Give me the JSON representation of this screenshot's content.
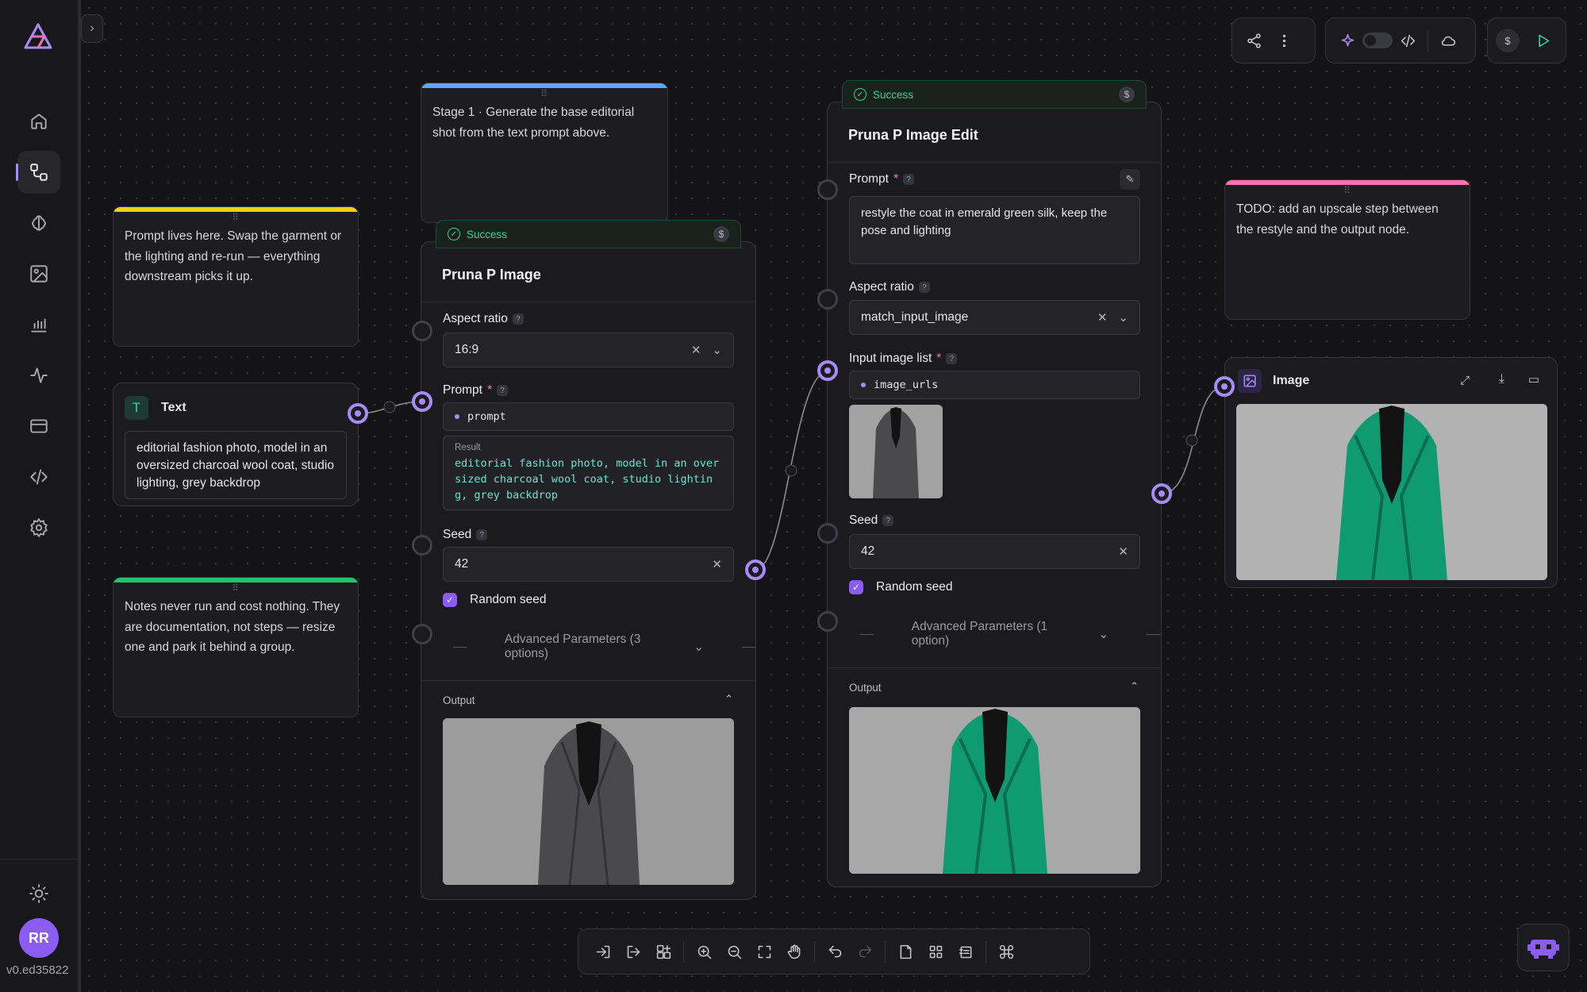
{
  "app": {
    "version": "v0.ed35822",
    "user_initials": "RR",
    "accent": "#a78bfa"
  },
  "sidebar": {
    "items": [
      {
        "name": "home",
        "icon": "home-icon",
        "active": false
      },
      {
        "name": "workflows",
        "icon": "workflow-icon",
        "active": true
      },
      {
        "name": "models",
        "icon": "brain-icon",
        "active": false
      },
      {
        "name": "gallery",
        "icon": "image-icon",
        "active": false
      },
      {
        "name": "analytics",
        "icon": "bar-chart-icon",
        "active": false
      },
      {
        "name": "activity",
        "icon": "activity-icon",
        "active": false
      },
      {
        "name": "billing",
        "icon": "credit-card-icon",
        "active": false
      },
      {
        "name": "api",
        "icon": "code-icon",
        "active": false
      },
      {
        "name": "settings",
        "icon": "gear-icon",
        "active": false
      }
    ]
  },
  "notes": {
    "yellow": {
      "text": "Prompt lives here. Swap the garment or the lighting and re-run — everything downstream picks it up.",
      "color": "#facc15"
    },
    "green": {
      "text": "Notes never run and cost nothing. They are documentation, not steps — resize one and park it behind a group.",
      "color": "#22c55e"
    },
    "blue": {
      "text": "Stage 1 · Generate the base editorial shot from the text prompt above.",
      "color": "#60a5fa"
    },
    "pink": {
      "text": "TODO: add an upscale step between the restyle and the output node.",
      "color": "#f472b6"
    }
  },
  "text_node": {
    "title": "Text",
    "value": "editorial fashion photo, model in an oversized charcoal wool coat, studio lighting, grey backdrop"
  },
  "node1": {
    "status": "Success",
    "title": "Pruna P Image",
    "aspect_label": "Aspect ratio",
    "aspect_value": "16:9",
    "prompt_label": "Prompt",
    "prompt_var": "prompt",
    "result_label": "Result",
    "result_value": "editorial fashion photo, model in an oversized charcoal wool coat, studio lighting, grey backdrop",
    "seed_label": "Seed",
    "seed_value": "42",
    "random_seed_label": "Random seed",
    "advanced_label": "Advanced Parameters (3 options)",
    "output_label": "Output"
  },
  "node2": {
    "status": "Success",
    "title": "Pruna P Image Edit",
    "prompt_label": "Prompt",
    "prompt_value": "restyle the coat in emerald green silk, keep the pose and lighting",
    "aspect_label": "Aspect ratio",
    "aspect_value": "match_input_image",
    "input_list_label": "Input image list",
    "input_var": "image_urls",
    "seed_label": "Seed",
    "seed_value": "42",
    "random_seed_label": "Random seed",
    "advanced_label": "Advanced Parameters (1 option)",
    "output_label": "Output"
  },
  "image_node": {
    "title": "Image"
  },
  "colors": {
    "coat_grey": "#4a4a4c",
    "coat_green": "#0f9a70",
    "success": "#34d399"
  }
}
